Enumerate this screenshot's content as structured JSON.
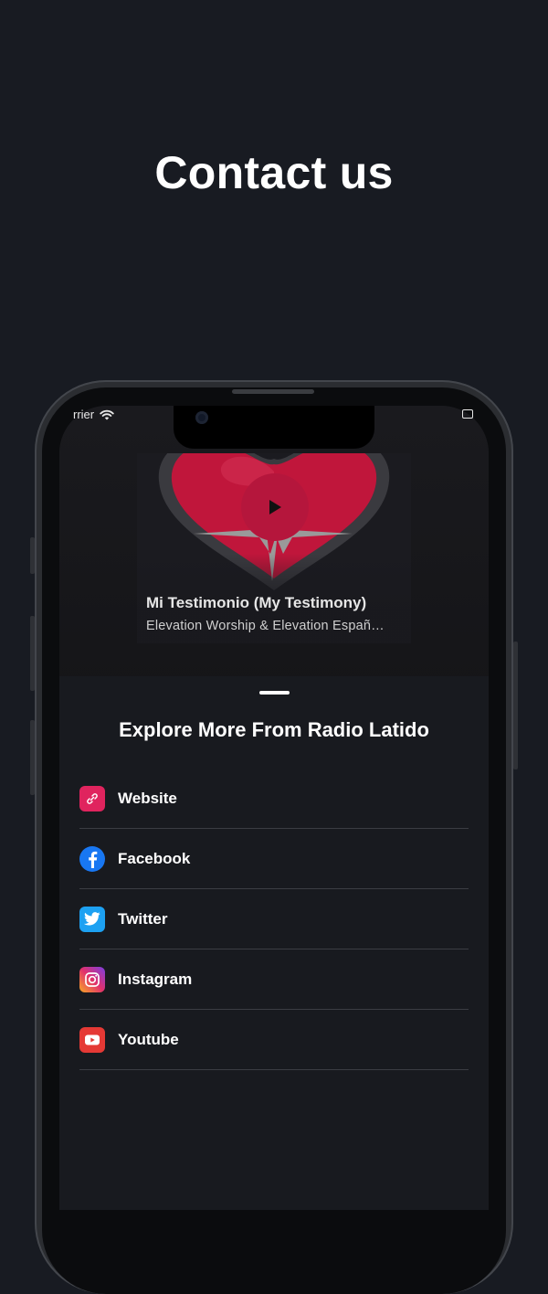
{
  "headline": "Contact us",
  "status_bar": {
    "carrier": "rrier"
  },
  "player": {
    "track_title": "Mi Testimonio (My Testimony)",
    "track_artist": "Elevation Worship & Elevation Españ…",
    "play_icon": "play-icon"
  },
  "sheet": {
    "title": "Explore More From Radio Latido",
    "links": [
      {
        "label": "Website",
        "icon": "link-icon",
        "color": "#e0245e"
      },
      {
        "label": "Facebook",
        "icon": "facebook-icon",
        "color": "#1877f2"
      },
      {
        "label": "Twitter",
        "icon": "twitter-icon",
        "color": "#1da1f2"
      },
      {
        "label": "Instagram",
        "icon": "instagram-icon",
        "color": "#d6249f"
      },
      {
        "label": "Youtube",
        "icon": "youtube-icon",
        "color": "#e62117"
      }
    ]
  },
  "colors": {
    "background": "#181b22",
    "accent": "#b5163c"
  }
}
